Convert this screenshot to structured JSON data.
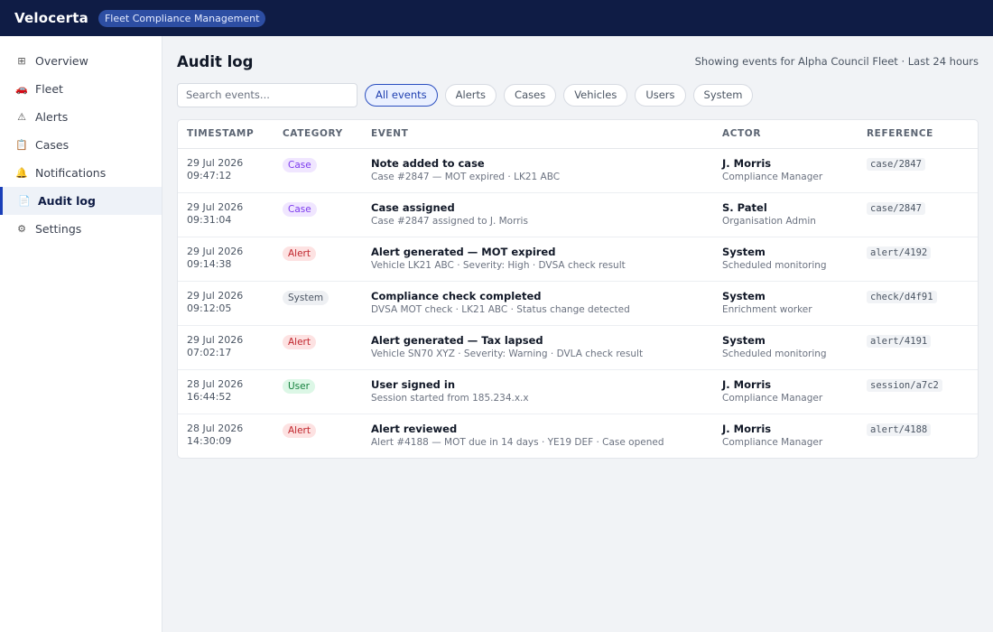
{
  "app": {
    "brand": "Velocerta",
    "badge": "Fleet Compliance Management"
  },
  "sidebar": {
    "items": [
      {
        "label": "Overview",
        "icon": "grid-icon",
        "glyph": "⊞",
        "active": false
      },
      {
        "label": "Fleet",
        "icon": "car-icon",
        "glyph": "🚗",
        "active": false
      },
      {
        "label": "Alerts",
        "icon": "warning-icon",
        "glyph": "⚠",
        "active": false
      },
      {
        "label": "Cases",
        "icon": "clipboard-icon",
        "glyph": "📋",
        "active": false
      },
      {
        "label": "Notifications",
        "icon": "bell-icon",
        "glyph": "🔔",
        "active": false
      },
      {
        "label": "Audit log",
        "icon": "document-icon",
        "glyph": "📄",
        "active": true
      },
      {
        "label": "Settings",
        "icon": "gear-icon",
        "glyph": "⚙",
        "active": false
      }
    ]
  },
  "main": {
    "title": "Audit log",
    "context": "Showing events for Alpha Council Fleet · Last 24 hours",
    "search": {
      "placeholder": "Search events...",
      "value": ""
    },
    "filters": [
      {
        "label": "All events",
        "active": true
      },
      {
        "label": "Alerts",
        "active": false
      },
      {
        "label": "Cases",
        "active": false
      },
      {
        "label": "Vehicles",
        "active": false
      },
      {
        "label": "Users",
        "active": false
      },
      {
        "label": "System",
        "active": false
      }
    ],
    "table": {
      "columns": [
        "TIMESTAMP",
        "CATEGORY",
        "EVENT",
        "ACTOR",
        "REFERENCE"
      ],
      "rows": [
        {
          "date": "29 Jul 2026",
          "time": "09:47:12",
          "category": "Case",
          "cat_class": "case",
          "event": "Note added to case",
          "detail": "Case #2847 — MOT expired · LK21 ABC",
          "actor": "J. Morris",
          "role": "Compliance Manager",
          "ref": "case/2847"
        },
        {
          "date": "29 Jul 2026",
          "time": "09:31:04",
          "category": "Case",
          "cat_class": "case",
          "event": "Case assigned",
          "detail": "Case #2847 assigned to J. Morris",
          "actor": "S. Patel",
          "role": "Organisation Admin",
          "ref": "case/2847"
        },
        {
          "date": "29 Jul 2026",
          "time": "09:14:38",
          "category": "Alert",
          "cat_class": "alert",
          "event": "Alert generated — MOT expired",
          "detail": "Vehicle LK21 ABC · Severity: High · DVSA check result",
          "actor": "System",
          "role": "Scheduled monitoring",
          "ref": "alert/4192"
        },
        {
          "date": "29 Jul 2026",
          "time": "09:12:05",
          "category": "System",
          "cat_class": "system",
          "event": "Compliance check completed",
          "detail": "DVSA MOT check · LK21 ABC · Status change detected",
          "actor": "System",
          "role": "Enrichment worker",
          "ref": "check/d4f91"
        },
        {
          "date": "29 Jul 2026",
          "time": "07:02:17",
          "category": "Alert",
          "cat_class": "alert",
          "event": "Alert generated — Tax lapsed",
          "detail": "Vehicle SN70 XYZ · Severity: Warning · DVLA check result",
          "actor": "System",
          "role": "Scheduled monitoring",
          "ref": "alert/4191"
        },
        {
          "date": "28 Jul 2026",
          "time": "16:44:52",
          "category": "User",
          "cat_class": "user",
          "event": "User signed in",
          "detail": "Session started from 185.234.x.x",
          "actor": "J. Morris",
          "role": "Compliance Manager",
          "ref": "session/a7c2"
        },
        {
          "date": "28 Jul 2026",
          "time": "14:30:09",
          "category": "Alert",
          "cat_class": "alert",
          "event": "Alert reviewed",
          "detail": "Alert #4188 — MOT due in 14 days · YE19 DEF · Case opened",
          "actor": "J. Morris",
          "role": "Compliance Manager",
          "ref": "alert/4188"
        }
      ]
    }
  },
  "colors": {
    "topbar": "#0f1c45",
    "accent": "#1a3fb8",
    "case_pill": "#7c3aed",
    "alert_pill": "#c0262d",
    "user_pill": "#15803d"
  }
}
